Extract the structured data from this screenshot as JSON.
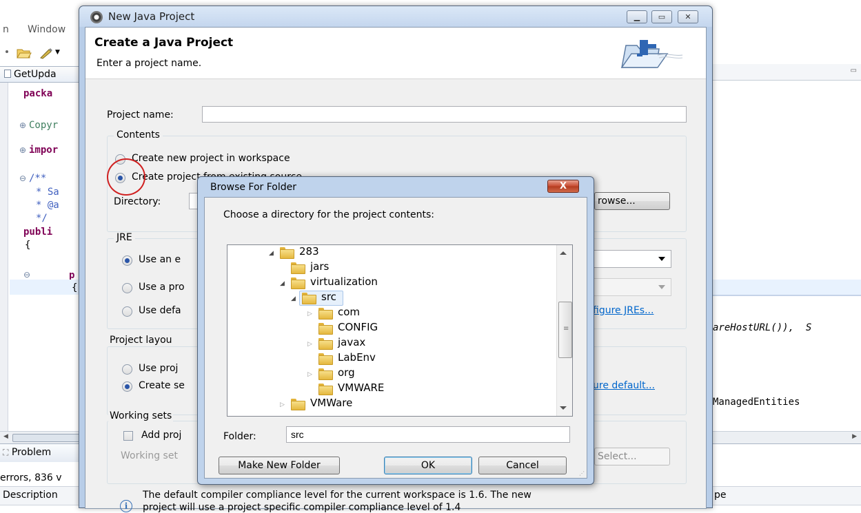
{
  "background": {
    "menu": [
      "n",
      "Window"
    ],
    "editor_tab": "GetUpda",
    "code_lines": [
      "packa",
      "Copyr",
      "impor",
      "/**",
      "* Sa",
      "* @a",
      "*/",
      "publi",
      "{",
      "p",
      "{"
    ],
    "code_right_1": "areHostURL()),  S",
    "code_right_2": "ManagedEntities",
    "problems_tab": "Problem",
    "errors_text": "errors, 836 v",
    "description_col": "Description",
    "type_col": "pe"
  },
  "dialog": {
    "title": "New Java Project",
    "header_title": "Create a Java Project",
    "header_subtitle": "Enter a project name.",
    "project_name_label": "Project name:",
    "project_name_value": "",
    "contents_label": "Contents",
    "radio_new": "Create new project in workspace",
    "radio_existing": "Create project from existing source",
    "directory_label": "Directory:",
    "browse_button": "rowse...",
    "jre_label": "JRE",
    "jre_opt1": "Use an e",
    "jre_opt2": "Use a pro",
    "jre_opt3": "Use defa",
    "configure_jres_link": "figure JREs...",
    "layout_label": "Project layou",
    "layout_opt1": "Use proj",
    "layout_opt2": "Create se",
    "configure_default_link": "ure default...",
    "working_sets_label": "Working sets",
    "add_project_label": "Add proj",
    "working_sets_field_label": "Working set",
    "select_button": "Select...",
    "info_text_1": "The default compiler compliance level for the current workspace is 1.6. The new",
    "info_text_2": "project will use a project specific compiler compliance level of 1.4"
  },
  "browse_dialog": {
    "title": "Browse For Folder",
    "close_label": "X",
    "prompt": "Choose a directory for the project contents:",
    "tree": [
      {
        "label": "283",
        "expanded": true
      },
      {
        "label": "jars"
      },
      {
        "label": "virtualization",
        "expanded": true
      },
      {
        "label": "src",
        "expanded": true,
        "selected": true
      },
      {
        "label": "com",
        "collapsed": true
      },
      {
        "label": "CONFIG"
      },
      {
        "label": "javax",
        "collapsed": true
      },
      {
        "label": "LabEnv"
      },
      {
        "label": "org",
        "collapsed": true
      },
      {
        "label": "VMWARE"
      },
      {
        "label": "VMWare",
        "collapsed": true
      }
    ],
    "folder_label": "Folder:",
    "folder_value": "src",
    "make_new_folder": "Make New Folder",
    "ok": "OK",
    "cancel": "Cancel"
  },
  "colors": {
    "accent_selection": "#e6f0fb",
    "radio_selected": "#2a55a8",
    "annotation_circle": "#d02020",
    "link": "#0066cc"
  }
}
